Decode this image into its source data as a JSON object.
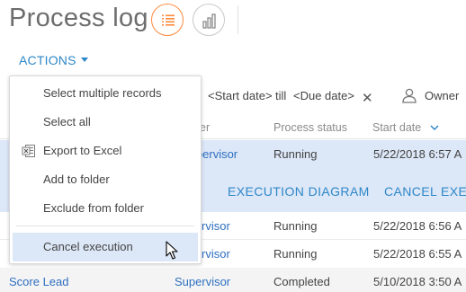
{
  "page": {
    "title": "Process log"
  },
  "view_switch": {
    "list_icon": "list-view-icon",
    "chart_icon": "chart-view-icon"
  },
  "toolbar": {
    "actions_label": "ACTIONS"
  },
  "filters": {
    "start_date": "<Start date>",
    "till": "till",
    "due_date": "<Due date>",
    "owner": "Owner"
  },
  "columns": {
    "owner_partial": "er",
    "status": "Process status",
    "start": "Start date"
  },
  "selected_row": {
    "owner": "Supervisor",
    "status": "Running",
    "start": "5/22/2018 6:57 A"
  },
  "row_actions": {
    "diagram": "EXECUTION DIAGRAM",
    "cancel": "CANCEL EXECU"
  },
  "rows": [
    {
      "owner": "rvisor",
      "status": "Running",
      "start": "5/22/2018 6:56 A"
    },
    {
      "owner": "rvisor",
      "status": "Running",
      "start": "5/22/2018 6:55 A"
    },
    {
      "name": "Score Lead",
      "owner": "Supervisor",
      "status": "Completed",
      "start": "5/10/2018 3:50 A"
    }
  ],
  "menu": {
    "items": [
      {
        "label": "Select multiple records"
      },
      {
        "label": "Select all"
      },
      {
        "label": "Export to Excel",
        "icon": "excel-icon"
      },
      {
        "label": "Add to folder"
      },
      {
        "label": "Exclude from folder"
      },
      {
        "label": "Cancel execution"
      }
    ]
  },
  "colors": {
    "accent": "#2e87c8",
    "selection": "#dce7f7",
    "active_view": "#ff8a3d"
  }
}
